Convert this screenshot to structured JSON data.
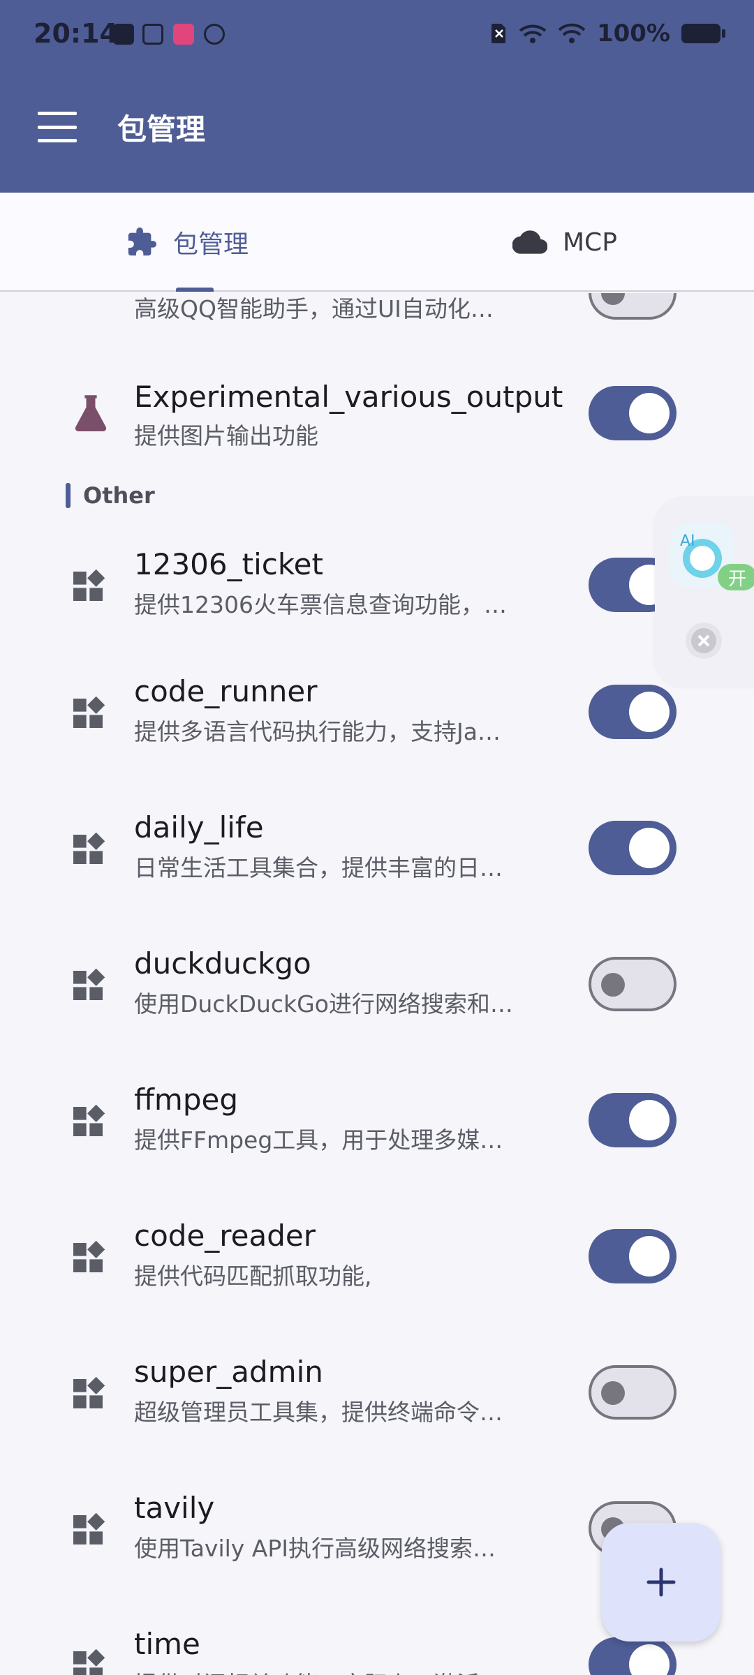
{
  "status_bar": {
    "time": "20:14",
    "battery": "100%"
  },
  "app_bar": {
    "title": "包管理"
  },
  "tabs": [
    {
      "label": "包管理",
      "icon": "puzzle-icon",
      "active": true
    },
    {
      "label": "MCP",
      "icon": "cloud-icon",
      "active": false
    }
  ],
  "partial_item": {
    "desc": "高级QQ智能助手，通过UI自动化…"
  },
  "experimental_item": {
    "title": "Experimental_various_output",
    "desc": "提供图片输出功能",
    "enabled": true
  },
  "section": {
    "label": "Other"
  },
  "items": [
    {
      "title": "12306_ticket",
      "desc": "提供12306火车票信息查询功能，…",
      "enabled": true
    },
    {
      "title": "code_runner",
      "desc": "提供多语言代码执行能力，支持Ja…",
      "enabled": true
    },
    {
      "title": "daily_life",
      "desc": "日常生活工具集合，提供丰富的日…",
      "enabled": true
    },
    {
      "title": "duckduckgo",
      "desc": "使用DuckDuckGo进行网络搜索和…",
      "enabled": false
    },
    {
      "title": "ffmpeg",
      "desc": "提供FFmpeg工具，用于处理多媒…",
      "enabled": true
    },
    {
      "title": "code_reader",
      "desc": "提供代码匹配抓取功能,",
      "enabled": true
    },
    {
      "title": "super_admin",
      "desc": "超级管理员工具集，提供终端命令…",
      "enabled": false
    },
    {
      "title": "tavily",
      "desc": "使用Tavily API执行高级网络搜索…",
      "enabled": false
    },
    {
      "title": "time",
      "desc": "提供时间相关功能，实际上，激活…",
      "enabled": true
    }
  ],
  "ai_assistant": {
    "badge": "开",
    "avatar_text": "AI"
  },
  "colors": {
    "primary": "#4f5d96",
    "background": "#f5f5fa",
    "experimental_icon": "#7a4f6a"
  }
}
